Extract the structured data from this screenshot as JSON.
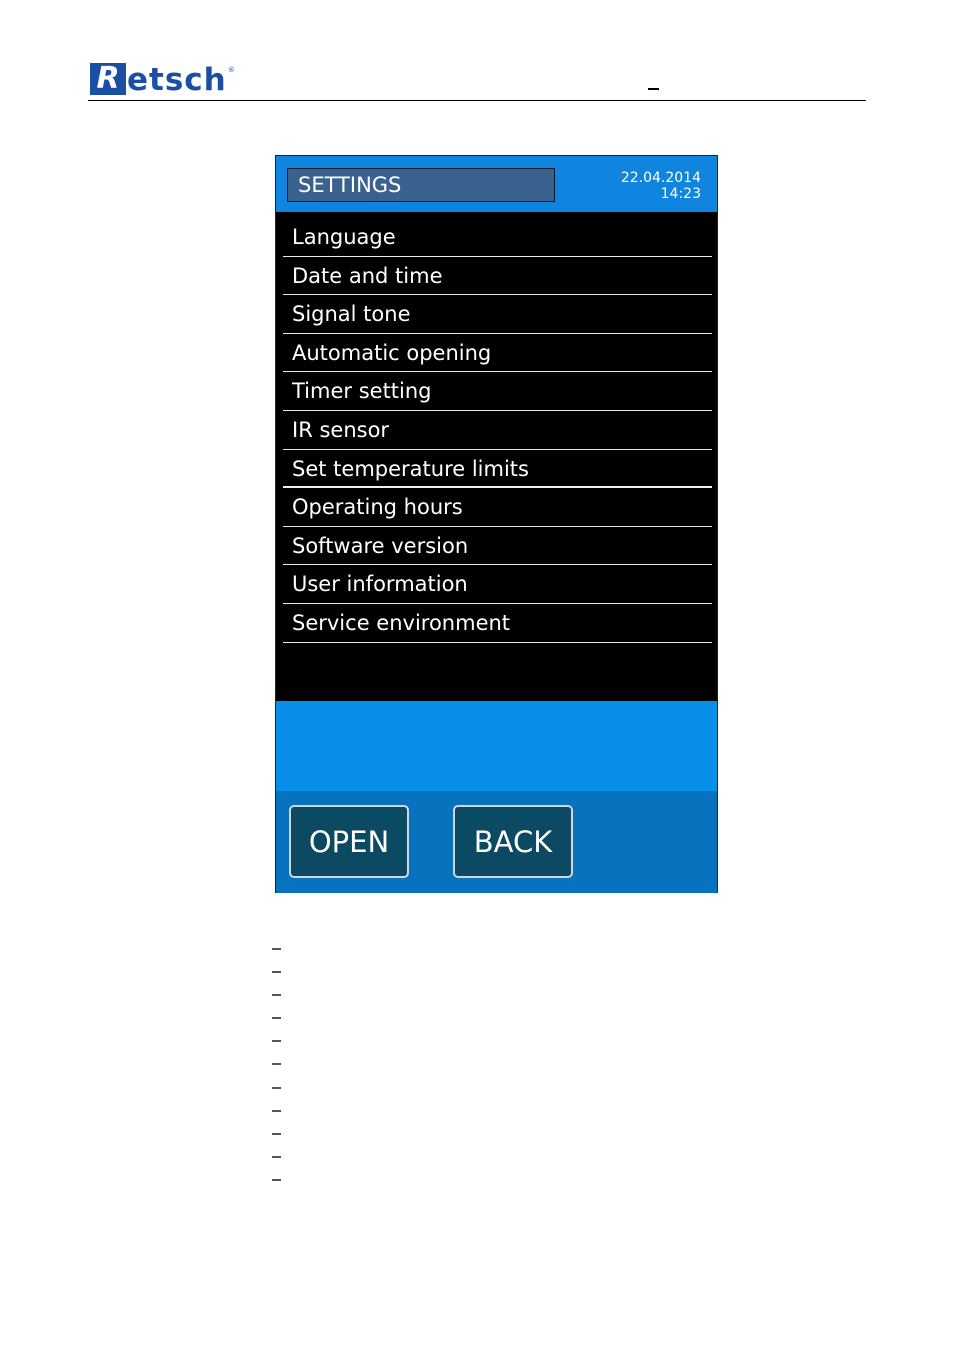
{
  "document_header": {
    "logo_letter": "R",
    "logo_text": "etsch",
    "logo_registered": "®",
    "brand_color": "#1b4fa3"
  },
  "screen": {
    "title": "SETTINGS",
    "date": "22.04.2014",
    "time": "14:23",
    "menu_items": [
      {
        "label": "Language"
      },
      {
        "label": "Date and time"
      },
      {
        "label": "Signal tone"
      },
      {
        "label": "Automatic opening"
      },
      {
        "label": "Timer setting"
      },
      {
        "label": "IR sensor"
      },
      {
        "label": "Set temperature limits"
      },
      {
        "label": "Operating hours"
      },
      {
        "label": "Software version"
      },
      {
        "label": "User information"
      },
      {
        "label": "Service environment"
      }
    ],
    "buttons": {
      "open_label": "OPEN",
      "back_label": "BACK"
    },
    "colors": {
      "title_bar": "#0f85e0",
      "title_box": "#3a628f",
      "info_area": "#078fe9",
      "button_bar": "#0772be",
      "button": "#0b4a62"
    }
  },
  "list_markers": [
    "–",
    "–",
    "–",
    "–",
    "–",
    "–",
    "–",
    "–",
    "–",
    "–",
    "–"
  ]
}
